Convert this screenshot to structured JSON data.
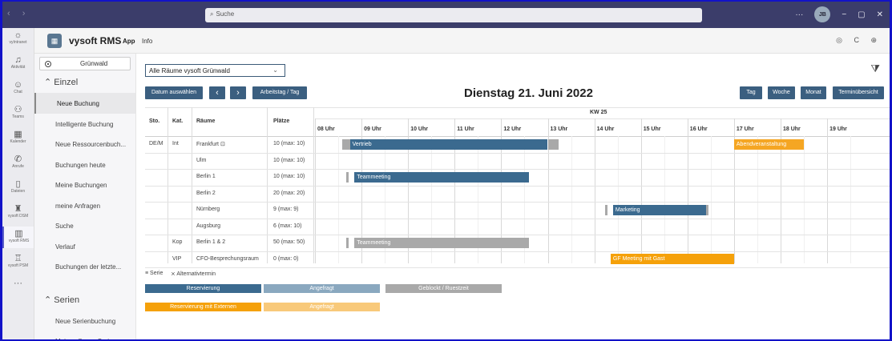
{
  "titlebar": {
    "nav": "‹ ›",
    "search_placeholder": "Suche",
    "more": "···",
    "avatar": "JB",
    "minimize": "−",
    "maximize": "▢",
    "close": "✕"
  },
  "rail": [
    {
      "icon": "☼",
      "label": "vyIntranet"
    },
    {
      "icon": "♫",
      "label": "Aktivität"
    },
    {
      "icon": "☺",
      "label": "Chat"
    },
    {
      "icon": "⚇",
      "label": "Teams"
    },
    {
      "icon": "▦",
      "label": "Kalender"
    },
    {
      "icon": "✆",
      "label": "Anrufe"
    },
    {
      "icon": "▯",
      "label": "Dateien"
    },
    {
      "icon": "♜",
      "label": "vysoft DSM"
    },
    {
      "icon": "▥",
      "label": "vysoft RMS"
    },
    {
      "icon": "♖",
      "label": "vysoft PSM"
    },
    {
      "icon": "···",
      "label": ""
    }
  ],
  "app": {
    "logo": "▦",
    "name": "vysoft RMS",
    "tabs": [
      "App",
      "Info"
    ],
    "icons": "◎ C ⊕"
  },
  "sidebar": {
    "location": "Grünwald",
    "section1": "Einzel",
    "items1": [
      "Neue Buchung",
      "Intelligente Buchung",
      "Neue Ressourcenbuch...",
      "Buchungen heute",
      "Meine Buchungen",
      "meine Anfragen",
      "Suche",
      "Verlauf",
      "Buchungen der letzte..."
    ],
    "section2": "Serien",
    "items2": [
      "Neue Serienbuchung",
      "Meine offenen Serien"
    ]
  },
  "main": {
    "select": "Alle Räume vysoft Grünwald",
    "buttons": {
      "date": "Datum auswählen",
      "prev": "‹",
      "next": "›",
      "workday": "Arbeitstag / Tag",
      "day": "Tag",
      "week": "Woche",
      "month": "Monat",
      "overview": "Terminübersicht"
    },
    "date_title": "Dienstag 21. Juni 2022",
    "week": "KW 25",
    "headers": {
      "sto": "Sto.",
      "kat": "Kat.",
      "raeume": "Räume",
      "plaetze": "Plätze"
    },
    "hours": [
      "08 Uhr",
      "09 Uhr",
      "10 Uhr",
      "11 Uhr",
      "12 Uhr",
      "13 Uhr",
      "14 Uhr",
      "15 Uhr",
      "16 Uhr",
      "17 Uhr",
      "18 Uhr",
      "19 Uhr"
    ],
    "rows": [
      {
        "sto": "DE/M",
        "kat": "Int",
        "room": "Frankfurt ⊡",
        "seats": "10 (max: 10)"
      },
      {
        "sto": "",
        "kat": "",
        "room": "Ulm",
        "seats": "10 (max: 10)"
      },
      {
        "sto": "",
        "kat": "",
        "room": "Berlin 1",
        "seats": "10 (max: 10)"
      },
      {
        "sto": "",
        "kat": "",
        "room": "Berlin 2",
        "seats": "20 (max: 20)"
      },
      {
        "sto": "",
        "kat": "",
        "room": "Nürnberg",
        "seats": "9 (max: 9)"
      },
      {
        "sto": "",
        "kat": "",
        "room": "Augsburg",
        "seats": "6 (max: 10)"
      },
      {
        "sto": "",
        "kat": "Kop",
        "room": "Berlin 1 & 2",
        "seats": "50 (max: 50)"
      },
      {
        "sto": "",
        "kat": "VIP",
        "room": "CFO-Besprechungsraum",
        "seats": "0 (max: 0)"
      }
    ],
    "bookings": [
      {
        "row": 0,
        "label": "Vertrieb",
        "color": "#3b6a8f"
      },
      {
        "row": 0,
        "label": "Abendveranstaltung",
        "color": "#f5a623"
      },
      {
        "row": 2,
        "label": "Teammeeting",
        "color": "#3b6a8f"
      },
      {
        "row": 4,
        "label": "Marketing",
        "color": "#3b6a8f"
      },
      {
        "row": 6,
        "label": "Teammeeting",
        "color": "#a9a9a9"
      },
      {
        "row": 7,
        "label": "GF Meeting mit Gast",
        "color": "#f5a10a"
      }
    ],
    "legend_note": {
      "serie": "≡ Serie",
      "alt": "⨯ Alternativtermin"
    },
    "legend": [
      {
        "label": "Reservierung",
        "color": "#3b6a8f"
      },
      {
        "label": "Angefragt",
        "color": "#8aa8bf"
      },
      {
        "label": "Geblockt / Ruestzeit",
        "color": "#a9a9a9"
      },
      {
        "label": "Reservierung mit Externen",
        "color": "#f5a10a"
      },
      {
        "label": "Angefragt",
        "color": "#f8c97a"
      }
    ]
  }
}
